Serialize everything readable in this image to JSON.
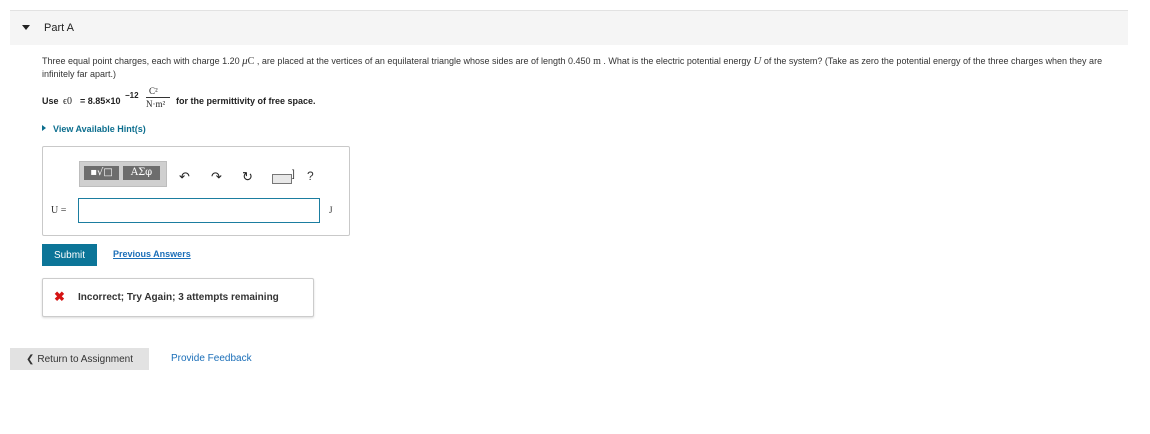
{
  "part": {
    "title": "Part A"
  },
  "question": {
    "t1": "Three equal point charges, each with charge 1.20 ",
    "mu": "μ",
    "C": "C",
    "t2": " , are placed at the vertices of an equilateral triangle whose sides are of length 0.450 ",
    "m": "m",
    "t3": " . What is the electric potential energy ",
    "U": "U",
    "t4": " of the system? (Take as zero the potential energy of the three charges when they are infinitely far apart.)"
  },
  "permittivity": {
    "use_label": "Use",
    "symbol": "ϵ0",
    "value": "= 8.85×10",
    "exponent": "−12",
    "numerator": "C²",
    "denominator": "N·m²",
    "suffix": "for the permittivity of free space."
  },
  "hint": {
    "label": "View Available Hint(s)"
  },
  "toolbar": {
    "templates_label": "▪√□",
    "symbols_label": "ΑΣφ",
    "undo_icon": "↶",
    "redo_icon": "↷",
    "reset_icon": "↻",
    "keyboard_bracket": "]",
    "help_label": "?"
  },
  "answer": {
    "variable_label": "U =",
    "value": "",
    "unit": "J"
  },
  "actions": {
    "submit_label": "Submit",
    "previous_answers_label": "Previous Answers"
  },
  "feedback": {
    "icon": "✖",
    "message": "Incorrect; Try Again; 3 attempts remaining"
  },
  "footer": {
    "return_chevron": "❮",
    "return_label": "Return to Assignment",
    "provide_feedback_label": "Provide Feedback"
  },
  "colors": {
    "accent": "#0c7598",
    "link": "#1a6eb8",
    "error": "#d51313"
  }
}
